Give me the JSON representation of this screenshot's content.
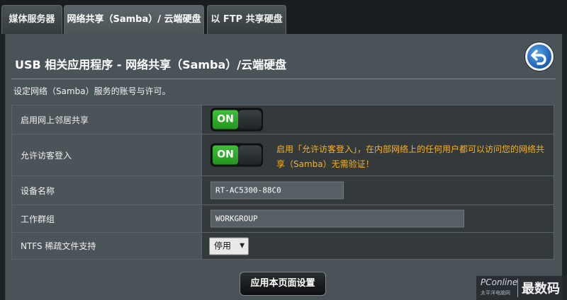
{
  "tabs": [
    {
      "label": "媒体服务器"
    },
    {
      "label": "网络共享（Samba）/ 云端硬盘"
    },
    {
      "label": "以 FTP 共享硬盘"
    }
  ],
  "page": {
    "title": "USB 相关应用程序 - 网络共享（Samba）/云端硬盘",
    "description": "设定网络（Samba）服务的账号与许可。",
    "back_icon": "back-arrow-icon"
  },
  "settings": {
    "network_neighborhood": {
      "label": "启用网上邻居共享",
      "toggle": "ON"
    },
    "guest_login": {
      "label": "允许访客登入",
      "toggle": "ON",
      "hint": "启用「允许访客登入」，在内部网络上的任何用户都可以访问您的网络共享（Samba）无需验证！"
    },
    "device_name": {
      "label": "设备名称",
      "value": "RT-AC5300-88C0"
    },
    "workgroup": {
      "label": "工作群组",
      "value": "WORKGROUP"
    },
    "ntfs_sparse": {
      "label": "NTFS 稀疏文件支持",
      "selected": "停用"
    }
  },
  "apply_button": {
    "label": "应用本页面设置"
  },
  "watermark": {
    "site": "PConline",
    "site_sub": "太平洋电脑网",
    "brand": "最数码"
  },
  "colors": {
    "toggle_on": "#2fa82a",
    "hint_text": "#f7b21e",
    "back_button": "#2a6fc0",
    "panel": "#4a5357"
  }
}
